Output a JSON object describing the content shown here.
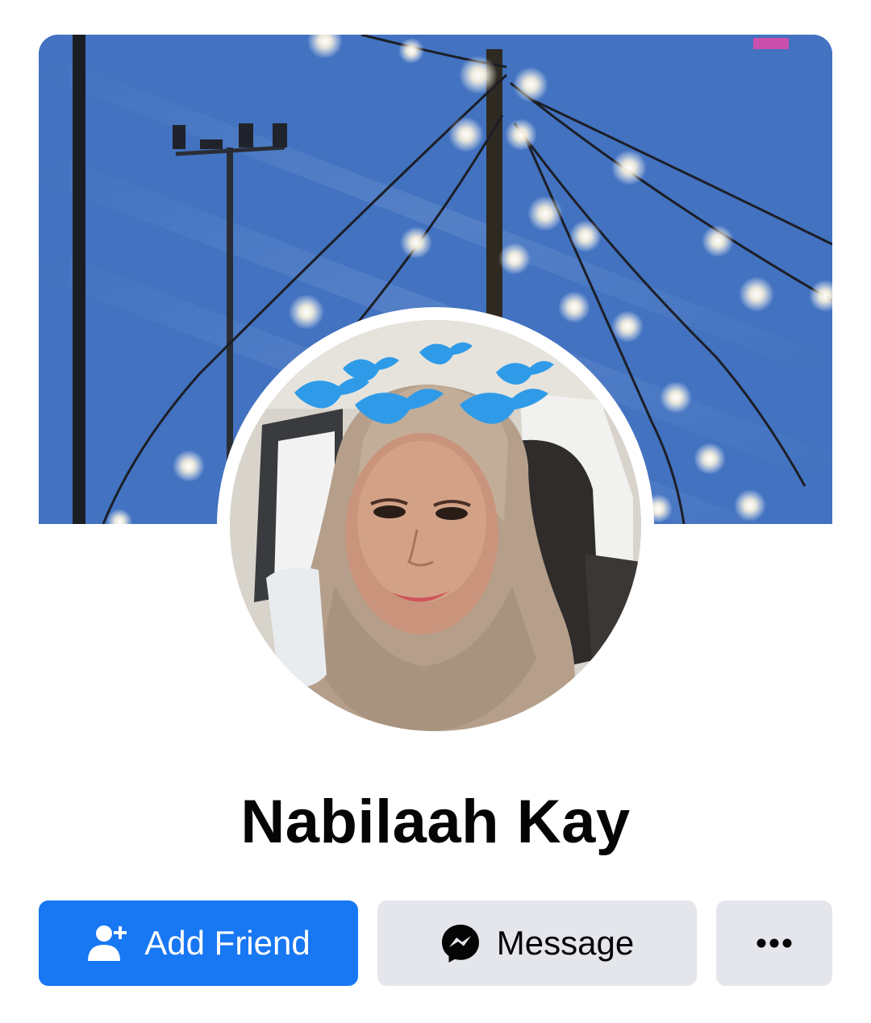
{
  "profile": {
    "cover_icon": "cover-photo-night-lights",
    "avatar_icon": "profile-photo",
    "name": "Nabilaah Kay"
  },
  "actions": {
    "add_friend": {
      "label": "Add Friend",
      "icon": "add-friend-icon",
      "color": "#1877f2"
    },
    "message": {
      "label": "Message",
      "icon": "messenger-icon",
      "color": "#e4e6eb"
    },
    "more": {
      "icon": "more-options-icon"
    }
  }
}
